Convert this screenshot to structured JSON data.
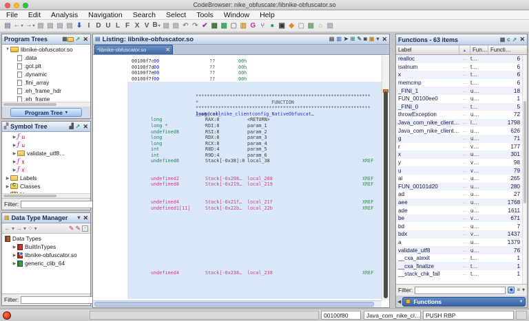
{
  "window": {
    "title": "CodeBrowser: nike_obfuscate:/libnike-obfuscator.so"
  },
  "menu": [
    "File",
    "Edit",
    "Analysis",
    "Navigation",
    "Search",
    "Select",
    "Tools",
    "Window",
    "Help"
  ],
  "toolbar": {
    "icons": [
      {
        "name": "save-icon",
        "glyph": "▤",
        "color": "#8090a8"
      },
      {
        "name": "nav-back-icon",
        "glyph": "←",
        "color": "#2e7da0",
        "dd": "1"
      },
      {
        "name": "nav-forward-icon",
        "glyph": "→",
        "color": "#2e7da0",
        "dd": "1"
      },
      {
        "name": "copy-icon",
        "glyph": "▤",
        "color": "#9aa4b0"
      },
      {
        "name": "paste-icon-1",
        "glyph": "▤",
        "color": "#9aa4b0"
      },
      {
        "name": "paste-icon-2",
        "glyph": "▤",
        "color": "#9aa4b0"
      },
      {
        "name": "paste-icon-3",
        "glyph": "▤",
        "color": "#9aa4b0"
      },
      {
        "name": "disassemble-icon",
        "glyph": "⬇",
        "color": "#2a5ac8"
      },
      {
        "name": "letter-button-I",
        "glyph": "I",
        "color": "#555"
      },
      {
        "name": "letter-button-D",
        "glyph": "D",
        "color": "#555"
      },
      {
        "name": "letter-button-U",
        "glyph": "U",
        "color": "#555"
      },
      {
        "name": "letter-button-L",
        "glyph": "L",
        "color": "#555"
      },
      {
        "name": "letter-button-F",
        "glyph": "F",
        "color": "#555"
      },
      {
        "name": "letter-button-X",
        "glyph": "X",
        "color": "#555"
      },
      {
        "name": "letter-button-V",
        "glyph": "V",
        "color": "#555"
      },
      {
        "name": "letter-button-B",
        "glyph": "B",
        "color": "#555",
        "dd": "1"
      },
      {
        "name": "clipboard-icon-1",
        "glyph": "▤",
        "color": "#9aa4b0"
      },
      {
        "name": "clipboard-icon-2",
        "glyph": "▤",
        "color": "#9aa4b0"
      },
      {
        "name": "undo-icon",
        "glyph": "↶",
        "color": "#8a8a8a"
      },
      {
        "name": "redo-icon",
        "glyph": "↷",
        "color": "#8a8a8a"
      },
      {
        "name": "validate-icon",
        "glyph": "✔",
        "color": "#a428b8"
      },
      {
        "name": "table-icon",
        "glyph": "▦",
        "color": "#3a6a3a"
      },
      {
        "name": "struct-editor-icon",
        "glyph": "▩",
        "color": "#3aa05a"
      },
      {
        "name": "window-icon",
        "glyph": "▢",
        "color": "#8a8a8a"
      },
      {
        "name": "memory-map-icon",
        "glyph": "▥",
        "color": "#c8922a"
      },
      {
        "name": "function-graph-icon",
        "glyph": "G",
        "color": "#c030a0"
      },
      {
        "name": "call-tree-icon",
        "glyph": "⑂",
        "color": "#7a8a9a"
      },
      {
        "name": "record-icon",
        "glyph": "●",
        "color": "#1fa048"
      },
      {
        "name": "bytes-viewer-icon",
        "glyph": "▣",
        "color": "#2a3a2a"
      },
      {
        "name": "diamond-icon",
        "glyph": "◆",
        "color": "#e08a2a"
      },
      {
        "name": "window2-icon",
        "glyph": "▢",
        "color": "#a0a8b0"
      },
      {
        "name": "snapshot-icon",
        "glyph": "▩",
        "color": "#7aa07a"
      },
      {
        "name": "hierarchy-icon",
        "glyph": "⌂",
        "color": "#9aa0a8"
      },
      {
        "name": "clone-icon",
        "glyph": "▤",
        "color": "#9aa4b0"
      }
    ]
  },
  "program_trees": {
    "title": "Program Trees",
    "root": "libnike-obfuscator.so",
    "sections": [
      {
        "label": ".data"
      },
      {
        "label": ".got.plt"
      },
      {
        "label": ".dynamic"
      },
      {
        "label": ".fini_array"
      },
      {
        "label": ".eh_frame_hdr"
      },
      {
        "label": ".eh_frame"
      }
    ],
    "button_label": "Program Tree"
  },
  "symbol_tree": {
    "title": "Symbol Tree",
    "items": [
      {
        "cls": "lvl2",
        "icon": "function-icon",
        "glyph": "ƒ",
        "label": "u",
        "lcls": "funclabel"
      },
      {
        "cls": "lvl2",
        "icon": "function-icon",
        "glyph": "ƒ",
        "label": "u",
        "lcls": "funclabel"
      },
      {
        "cls": "lvl2",
        "icon": "folder-icon",
        "glyph": "",
        "label": "validate_utf8…",
        "lcls": ""
      },
      {
        "cls": "lvl2",
        "icon": "function-icon",
        "glyph": "ƒ",
        "label": "x",
        "lcls": "funclabel"
      },
      {
        "cls": "lvl2",
        "icon": "function-icon",
        "glyph": "ƒ",
        "label": "x",
        "lcls": "funclabel"
      },
      {
        "cls": "lvl1",
        "icon": "folder-icon",
        "glyph": "",
        "label": "Labels",
        "lcls": ""
      },
      {
        "cls": "lvl1",
        "icon": "classes-icon",
        "glyph": "",
        "label": "Classes",
        "lcls": ""
      },
      {
        "cls": "lvl1",
        "icon": "namespaces-icon",
        "glyph": "",
        "label": "Namespaces",
        "lcls": ""
      }
    ],
    "filter_label": "Filter:"
  },
  "data_type_manager": {
    "title": "Data Type Manager",
    "root": "Data Types",
    "items": [
      {
        "icon": "book-red-icon",
        "label": "BuiltInTypes"
      },
      {
        "icon": "book-red-dot-icon",
        "label": "libnike-obfuscator.so"
      },
      {
        "icon": "book-green-icon",
        "label": "generic_clib_64"
      }
    ],
    "filter_label": "Filter:"
  },
  "listing": {
    "title": "Listing:",
    "file": "libnike-obfuscator.so",
    "tab_label": "*libnike-obfuscator.so",
    "lines": [
      {
        "cls": "byte",
        "addr": "00100f7c",
        "b": "00",
        "q": "??",
        "v": "00h"
      },
      {
        "cls": "byte",
        "addr": "00100f7d",
        "b": "00",
        "q": "??",
        "v": "00h"
      },
      {
        "cls": "byte",
        "addr": "00100f7e",
        "b": "00",
        "q": "??",
        "v": "00h"
      },
      {
        "cls": "byte",
        "addr": "00100f7f",
        "b": "00",
        "q": "??",
        "v": "00h"
      },
      {
        "cls": "blank hl"
      },
      {
        "cls": "blank hl"
      },
      {
        "cls": "sep hl",
        "sep": "**************************************************************"
      },
      {
        "cls": "plate hl",
        "star": "*",
        "plate": "FUNCTION"
      },
      {
        "cls": "sep hl",
        "sep": "**************************************************************"
      },
      {
        "cls": "sig hl",
        "ret": "long",
        "conv": "__stdcall",
        "fname": "Java_com_nike_clientconfig_NativeObfuscat…"
      },
      {
        "cls": "var hl",
        "type": "long",
        "stor": "RAX:8",
        "vname": "<RETURN>"
      },
      {
        "cls": "var hl",
        "type": "long *",
        "stor": "RDI:8",
        "vname": "param_1"
      },
      {
        "cls": "var hl",
        "type": "undefined8",
        "stor": "RSI:8",
        "vname": "param_2"
      },
      {
        "cls": "var hl",
        "type": "long",
        "stor": "RDX:8",
        "vname": "param_3"
      },
      {
        "cls": "var hl",
        "type": "long",
        "stor": "RCX:8",
        "vname": "param_4"
      },
      {
        "cls": "var hl",
        "type": "int",
        "stor": "R8D:4",
        "vname": "param_5"
      },
      {
        "cls": "var hl",
        "type": "int",
        "stor": "R9D:4",
        "vname": "param_6"
      },
      {
        "cls": "var hl",
        "type": "undefined8",
        "stor": "Stack[-0x38]:8",
        "vname": "local_38",
        "xref": "XREF"
      },
      {
        "cls": "blank hl"
      },
      {
        "cls": "blank hl"
      },
      {
        "cls": "var hl m",
        "type": "undefined2",
        "stor": "Stack[-0x208…",
        "vname": "local_208",
        "xref": "XREF"
      },
      {
        "cls": "var hl m",
        "type": "undefined8",
        "stor": "Stack[-0x219…",
        "vname": "local_219",
        "xref": "XREF"
      },
      {
        "cls": "blank hl"
      },
      {
        "cls": "blank hl"
      },
      {
        "cls": "var hl m",
        "type": "undefined4",
        "stor": "Stack[-0x21f…",
        "vname": "local_21f",
        "xref": "XREF"
      },
      {
        "cls": "var hl m",
        "type": "undefined1[11]",
        "stor": "Stack[-0x22b…",
        "vname": "local_22b",
        "xref": "XREF"
      },
      {
        "cls": "blank hl"
      },
      {
        "cls": "blank hl"
      },
      {
        "cls": "blank hl"
      },
      {
        "cls": "blank hl"
      },
      {
        "cls": "blank hl"
      },
      {
        "cls": "blank hl"
      },
      {
        "cls": "blank hl"
      },
      {
        "cls": "blank hl"
      },
      {
        "cls": "blank hl"
      },
      {
        "cls": "blank hl"
      },
      {
        "cls": "var hl m",
        "type": "undefined4",
        "stor": "Stack[-0x238…",
        "vname": "local_238",
        "xref": "XREF"
      },
      {
        "cls": "blank hl"
      },
      {
        "cls": "blank hl"
      },
      {
        "cls": "blank hl"
      },
      {
        "cls": "blank hl"
      }
    ]
  },
  "functions": {
    "title": "Functions - 63 items",
    "col_label": "Label",
    "col_fun": "Fun…",
    "col_size": "Functi…",
    "rows": [
      {
        "label": "realloc",
        "dots": "…",
        "fun": "t…",
        "size": "6"
      },
      {
        "label": "isalnum",
        "dots": "…",
        "fun": "t…",
        "size": "6"
      },
      {
        "label": "x",
        "dots": "…",
        "fun": "t…",
        "size": "6"
      },
      {
        "label": "memcmp",
        "dots": "…",
        "fun": "t…",
        "size": "6"
      },
      {
        "label": "_FINI_1",
        "dots": "…",
        "fun": "u…",
        "size": "18"
      },
      {
        "label": "FUN_00100ee0",
        "dots": "…",
        "fun": "u…",
        "size": "1"
      },
      {
        "label": "_FINI_0",
        "dots": "…",
        "fun": "t…",
        "size": "5"
      },
      {
        "label": "throwException",
        "dots": "…",
        "fun": "u…",
        "size": "72"
      },
      {
        "label": "Java_com_nike_client…",
        "dots": "…",
        "fun": "l…",
        "size": "1798"
      },
      {
        "label": "Java_com_nike_client…",
        "dots": "…",
        "fun": "u…",
        "size": "626"
      },
      {
        "label": "g",
        "dots": "…",
        "fun": "u…",
        "size": "71"
      },
      {
        "label": "r",
        "dots": "…",
        "fun": "v…",
        "size": "177"
      },
      {
        "label": "x",
        "dots": "…",
        "fun": "u…",
        "size": "301"
      },
      {
        "label": "y",
        "dots": "…",
        "fun": "v…",
        "size": "98"
      },
      {
        "label": "u",
        "dots": "…",
        "fun": "v…",
        "size": "79"
      },
      {
        "label": "ai",
        "dots": "…",
        "fun": "u…",
        "size": "265"
      },
      {
        "label": "FUN_00101d20",
        "dots": "…",
        "fun": "u…",
        "size": "280"
      },
      {
        "label": "ad",
        "dots": "…",
        "fun": "u…",
        "size": "27"
      },
      {
        "label": "aee",
        "dots": "…",
        "fun": "u…",
        "size": "1768"
      },
      {
        "label": "ade",
        "dots": "…",
        "fun": "u…",
        "size": "1611"
      },
      {
        "label": "be",
        "dots": "…",
        "fun": "v…",
        "size": "671"
      },
      {
        "label": "bd",
        "dots": "…",
        "fun": "u…",
        "size": "7"
      },
      {
        "label": "bdx",
        "dots": "…",
        "fun": "v…",
        "size": "1437"
      },
      {
        "label": "a",
        "dots": "…",
        "fun": "u…",
        "size": "1379"
      },
      {
        "label": "validate_utf8",
        "dots": "…",
        "fun": "u…",
        "size": "76"
      },
      {
        "label": "__cxa_atexit",
        "dots": "…",
        "fun": "t…",
        "size": "1"
      },
      {
        "label": "__cxa_finalize",
        "dots": "…",
        "fun": "t…",
        "size": "1"
      },
      {
        "label": "__stack_chk_fail",
        "dots": "…",
        "fun": "t…",
        "size": "1"
      }
    ],
    "filter_label": "Filter:",
    "tab_label": "Functions"
  },
  "status": {
    "address": "00100f80",
    "context": "Java_com_nike_cl…",
    "instruction": "PUSH RBP"
  }
}
